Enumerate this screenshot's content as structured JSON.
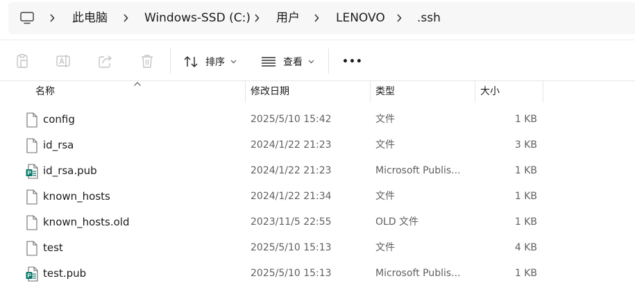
{
  "address_bar": {
    "icon": "this-pc-icon",
    "crumbs": [
      "此电脑",
      "Windows-SSD (C:)",
      "用户",
      "LENOVO",
      ".ssh"
    ]
  },
  "toolbar": {
    "icons": [
      "paste-icon",
      "rename-icon",
      "share-icon",
      "delete-icon"
    ],
    "sort_label": "排序",
    "view_label": "查看",
    "more_label": "•••"
  },
  "columns": {
    "name": "名称",
    "date": "修改日期",
    "type": "类型",
    "size": "大小"
  },
  "files": [
    {
      "name": "config",
      "date": "2025/5/10 15:42",
      "type": "文件",
      "size": "1 KB",
      "icon": "generic-file-icon"
    },
    {
      "name": "id_rsa",
      "date": "2024/1/22 21:23",
      "type": "文件",
      "size": "3 KB",
      "icon": "generic-file-icon"
    },
    {
      "name": "id_rsa.pub",
      "date": "2024/1/22 21:23",
      "type": "Microsoft Publis...",
      "size": "1 KB",
      "icon": "publisher-file-icon"
    },
    {
      "name": "known_hosts",
      "date": "2024/1/22 21:34",
      "type": "文件",
      "size": "1 KB",
      "icon": "generic-file-icon"
    },
    {
      "name": "known_hosts.old",
      "date": "2023/11/5 22:55",
      "type": "OLD 文件",
      "size": "1 KB",
      "icon": "generic-file-icon"
    },
    {
      "name": "test",
      "date": "2025/5/10 15:13",
      "type": "文件",
      "size": "4 KB",
      "icon": "generic-file-icon"
    },
    {
      "name": "test.pub",
      "date": "2025/5/10 15:13",
      "type": "Microsoft Publis...",
      "size": "1 KB",
      "icon": "publisher-file-icon"
    }
  ],
  "colors": {
    "address_bg": "#f7f7f7",
    "publisher_green": "#077568",
    "muted_text": "#5f5f5f",
    "disabled_icon": "#c4c4c4"
  }
}
